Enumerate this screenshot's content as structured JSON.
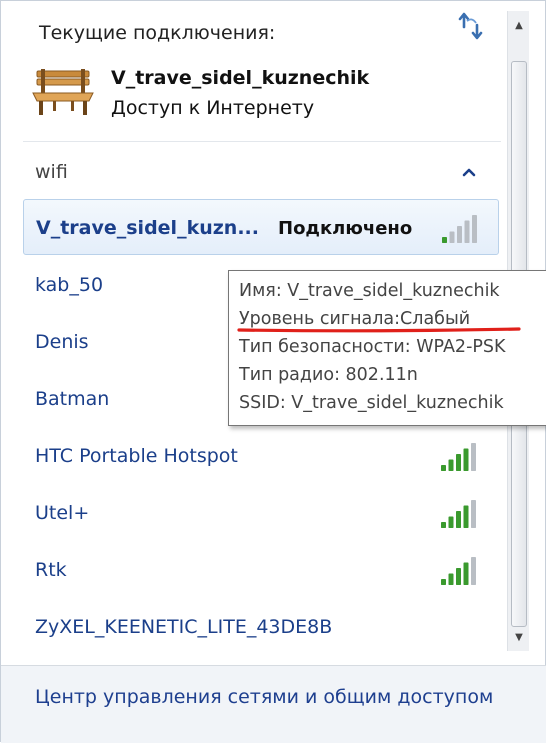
{
  "header": {
    "title": "Текущие подключения:",
    "refresh_icon": "refresh-icon"
  },
  "current_connection": {
    "name": "V_trave_sidel_kuznechik",
    "status": "Доступ к Интернету",
    "icon": "bench-icon"
  },
  "group": {
    "label": "wifi",
    "collapse_icon": "chevron-up-icon"
  },
  "networks": [
    {
      "name": "V_trave_sidel_kuzn...",
      "status": "Подключено",
      "signal_icon": "wifi-signal-icon",
      "signal_level": 1,
      "selected": true
    },
    {
      "name": "kab_50"
    },
    {
      "name": "Denis"
    },
    {
      "name": "Batman"
    },
    {
      "name": "HTC Portable Hotspot",
      "signal_icon": "wifi-signal-icon",
      "signal_level": 4
    },
    {
      "name": "Utel+",
      "signal_icon": "wifi-signal-icon",
      "signal_level": 4
    },
    {
      "name": "Rtk",
      "signal_icon": "wifi-signal-icon",
      "signal_level": 4
    },
    {
      "name": "ZyXEL_KEENETIC_LITE_43DE8B"
    }
  ],
  "tooltip": {
    "lines": [
      "Имя: V_trave_sidel_kuznechik",
      "Уровень сигнала:Слабый",
      "Тип безопасности: WPA2-PSK",
      "Тип радио: 802.11n",
      "SSID: V_trave_sidel_kuznechik"
    ],
    "highlight_color": "#e0201a"
  },
  "footer": {
    "link": "Центр управления сетями и общим доступом"
  },
  "colors": {
    "link": "#1b3f8a",
    "signal_on": "#3a9a2e",
    "signal_off": "#b9bec4"
  }
}
